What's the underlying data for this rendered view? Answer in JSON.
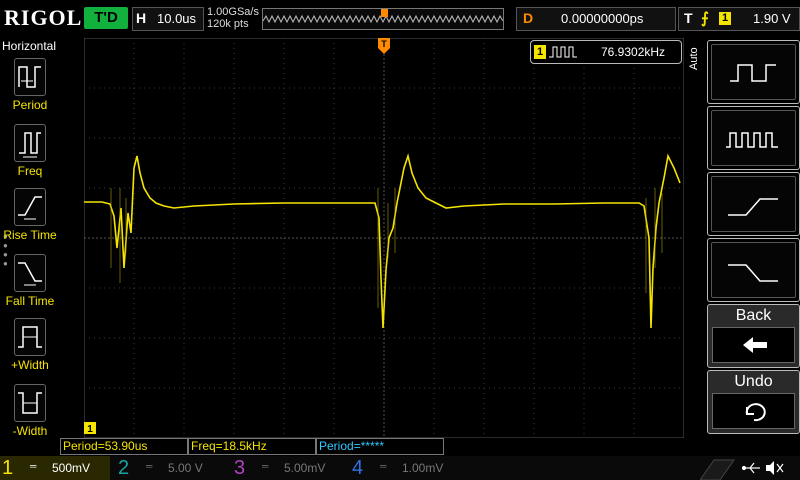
{
  "brand": "RIGOL",
  "run_state": "T'D",
  "horizontal": {
    "key": "H",
    "timebase": "10.0us"
  },
  "sampling": {
    "rate": "1.00GSa/s",
    "points": "120k pts"
  },
  "delay": {
    "key": "D",
    "value": "0.00000000ps"
  },
  "trigger": {
    "key": "T",
    "slope_symbol": "⨍",
    "source": "1",
    "level": "1.90 V"
  },
  "left_menu": {
    "title": "Horizontal",
    "items": [
      {
        "label": "Period",
        "icon": "period-icon"
      },
      {
        "label": "Freq",
        "icon": "freq-icon"
      },
      {
        "label": "Rise Time",
        "icon": "rise-time-icon"
      },
      {
        "label": "Fall Time",
        "icon": "fall-time-icon"
      },
      {
        "label": "+Width",
        "icon": "pos-width-icon"
      },
      {
        "label": "-Width",
        "icon": "neg-width-icon"
      }
    ]
  },
  "freq_counter": {
    "channel": "1",
    "value": "76.9302kHz"
  },
  "right_panel": {
    "mode": "Auto",
    "buttons": [
      {
        "name": "single-period-button",
        "icon": "single-period-wave-icon"
      },
      {
        "name": "multi-period-button",
        "icon": "multi-period-wave-icon"
      },
      {
        "name": "rise-edge-button",
        "icon": "rise-edge-icon"
      },
      {
        "name": "fall-edge-button",
        "icon": "fall-edge-icon"
      }
    ],
    "back_label": "Back",
    "undo_label": "Undo"
  },
  "measurements": [
    {
      "label": "Period=53.90us",
      "color": "#f5e400"
    },
    {
      "label": "Freq=18.5kHz",
      "color": "#f5e400"
    },
    {
      "label": "Period=*****",
      "color": "#36c8ff"
    }
  ],
  "ground_marker": "1",
  "channels": [
    {
      "num": "1",
      "scale": "500mV",
      "color": "#f5e400",
      "active": true
    },
    {
      "num": "2",
      "scale": "5.00 V",
      "color": "#19a3a3",
      "active": false
    },
    {
      "num": "3",
      "scale": "5.00mV",
      "color": "#b040c0",
      "active": false
    },
    {
      "num": "4",
      "scale": "1.00mV",
      "color": "#3070e0",
      "active": false
    }
  ],
  "colors": {
    "ch1": "#f5e400",
    "accent_orange": "#ff8a00",
    "grid": "#3a3a3a"
  }
}
